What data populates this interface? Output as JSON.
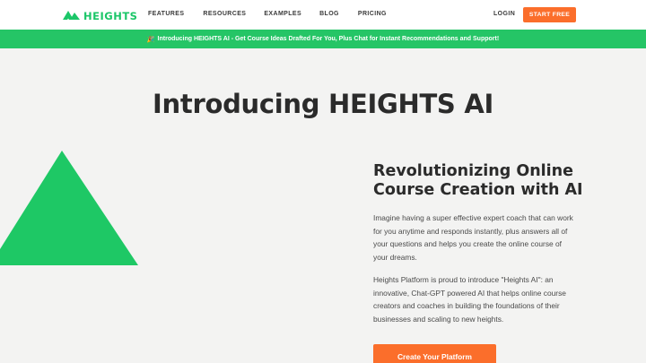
{
  "brand": {
    "name": "HEIGHTS",
    "icon": "mountains-logo-icon",
    "color": "#1bc668"
  },
  "nav": {
    "links": [
      "FEATURES",
      "RESOURCES",
      "EXAMPLES",
      "BLOG",
      "PRICING"
    ],
    "login_label": "LOGIN",
    "start_label": "START FREE"
  },
  "announcement": {
    "emoji": "🎉",
    "text": "Introducing HEIGHTS AI - Get Course Ideas Drafted For You, Plus Chat for Instant Recommendations and Support!",
    "background": "#25c566"
  },
  "hero": {
    "title": "Introducing HEIGHTS AI",
    "subheading": "Revolutionizing Online Course Creation with AI",
    "paragraph1": "Imagine having a super effective expert coach that can work for you anytime and responds instantly, plus answers all of your questions and helps you create the online course of your dreams.",
    "paragraph2": "Heights Platform is proud to introduce \"Heights AI\": an innovative, Chat-GPT powered AI that helps online course creators and coaches in building the foundations of their businesses and scaling to new heights.",
    "cta_label": "Create Your Platform",
    "accent_color": "#fb6e2b",
    "shape_icon": "green-triangle-icon"
  }
}
